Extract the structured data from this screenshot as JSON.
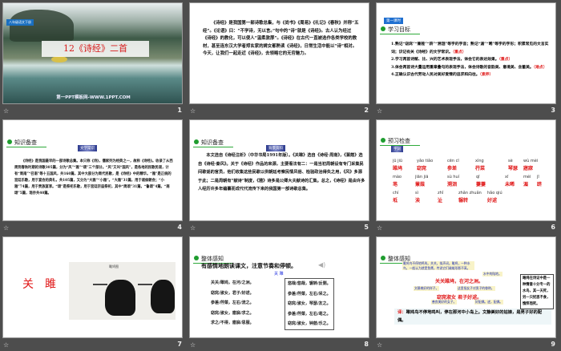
{
  "slides": [
    {
      "number": "1",
      "badge": "八年级语文下册",
      "title": "12《诗经》二首",
      "footer": "第一PPT模板网-WWW.1PPT.COM"
    },
    {
      "number": "2",
      "paragraph": "《诗经》是我国第一部诗歌总集，与《尚书》《周易》《礼记》《春秋》并称“五经”。《论语》曰：“不学诗，无以言。”句中的“诗”就是《诗经》。古人认为经过《诗经》的教化，可以使人“温柔敦厚”。《诗经》在古代一直被选作各类学校的教材，甚至连东汉大学者郑玄家的婢女都熟读《诗经》，日常生活中能以“诗”相对。今天，让我们一起走近《诗经》，去领略它的无穷魅力。"
    },
    {
      "number": "3",
      "badge": "第一课时",
      "heading": "学习目标",
      "goals": [
        {
          "text": "1.熟记“窈窕”“蒹葭”“跻”“溯洄”等字的字音；熟记“湄”“晞”等字的字形；积累常见的文言实词；识记有关《诗经》的文学常识。",
          "tag": "（重点）"
        },
        {
          "text": "2.学习两首诗赋、比、兴的艺术表现手法，体会它的表达效果。",
          "tag": "（重点）"
        },
        {
          "text": "3.体会两首诗大量运用重章叠句的表现手法，体会诗歌的音韵美、意境美、含蓄美。",
          "tag": "（难点）"
        },
        {
          "text": "4.正确认识古代劳动人民对美好爱情的追求和向往。",
          "tag": "（素养）"
        }
      ]
    },
    {
      "number": "4",
      "heading": "知识备查",
      "badge": "文学常识",
      "paragraph": "《诗经》是我国最早的一部诗歌总集。本只称《诗》，儒家列为经典之一，故称《诗经》。收录了从西周到春秋时期的诗歌305篇，分为“风”“雅”“颂”三个部分。“风”又叫“国风”，是各地的民歌民谣，计有“周南”“召南”等十五国风，共160篇，其中大部分为周代民歌，是《诗经》中的精华。“雅”是正统的宫廷乐歌，用于宴会的典礼，共105篇，又分为“大雅”“小雅”。“大雅”31篇，用于诸侯朝会；“小雅”74篇，用于贵族宴享。“颂”是祭祀乐歌，用于宫廷宗庙祭祀，其中“周颂”31篇，“鲁颂”4篇，“商颂”5篇，现存共40篇。"
    },
    {
      "number": "5",
      "heading": "知识备查",
      "badge": "背景资料",
      "paragraph": "本文选自《诗经注析》（中华书局1991年版）。《关雎》选自《诗经·周南》，《蒹葭》选自《诗经·秦风》。关于《诗经》作品的来源，主要看法有二：一是当初周朝设有专门采集民间歌谣的官员，他们收集这些民歌以供朝廷考察民情风俗、检验政治得失之用，《风》多源于此；二是周朝有“献诗”制度，《雅》诗多是公卿大夫献诗的汇集。总之，《诗经》是由许多人经历许多年编纂而成代代流传下来的我国第一部诗歌总集。"
    },
    {
      "number": "6",
      "heading": "预习检查",
      "badge": "字词",
      "words": [
        {
          "py": "jū jiū",
          "hz": "雎鸠"
        },
        {
          "py": "yǎo tiǎo",
          "hz": "窈窕"
        },
        {
          "py": "cēn cī",
          "hz": "参差"
        },
        {
          "py": "xìng",
          "hz": "荇菜"
        },
        {
          "py": "sè",
          "hz": "琴瑟"
        },
        {
          "py": "wù mèi",
          "hz": "寤寐"
        },
        {
          "py": "mào",
          "hz": "芼"
        },
        {
          "py": "jiān jiā",
          "hz": "蒹葭"
        },
        {
          "py": "sù huí",
          "hz": "溯洄"
        },
        {
          "py": "qī",
          "hz": "萋萋"
        },
        {
          "py": "xī",
          "hz": "未晞"
        },
        {
          "py": "méi",
          "hz": "湄"
        },
        {
          "py": "jī",
          "hz": "跻"
        },
        {
          "py": "chí",
          "hz": "坻"
        },
        {
          "py": "sì",
          "hz": "涘"
        },
        {
          "py": "zhǐ",
          "hz": "沚"
        },
        {
          "py": "zhǎn zhuǎn",
          "hz": "辗转"
        },
        {
          "py": "hǎo qiú",
          "hz": "好逑"
        }
      ]
    },
    {
      "number": "7",
      "title": "关　雎",
      "painting_inscription": "雎鸠图"
    },
    {
      "number": "8",
      "heading": "整体感知",
      "instruction": "有感情地朗读课文，注意节奏和停顿。",
      "poem_title": "关 雎",
      "left_lines": [
        "关关/雎鸠，在河/之洲。",
        "窈窕/淑女，君子/好逑。",
        "参差/荇菜，左右/流之。",
        "窈窕/淑女，寤寐/求之。",
        "求之/不得，寤寐/思服。"
      ],
      "right_lines": [
        "悠哉/悠哉，辗转/反侧。",
        "参差/荇菜，左右/采之。",
        "窈窕/淑女，琴瑟/友之。",
        "参差/荇菜，左右/芼之。",
        "窈窕/淑女，钟鼓/乐之。"
      ]
    },
    {
      "number": "9",
      "heading": "整体感知",
      "notes": [
        "雎鸠鸟不停地鸣叫。关关，拟声词。雎鸠，一种水鸟，一般认为就是鱼鹰，传说它们雌雄形影不离。",
        "水中的陆地。",
        "文静美好的样子。",
        "这里指女子对男子的尊称。",
        "善良美好的女子。",
        "好配偶。逑，配偶。"
      ],
      "line1": "关关雎鸠，在河之洲。",
      "line2a": "窈窕淑女",
      "line2b": "君子好逑。",
      "translation_label": "译：",
      "translation": "雎鸠鸟不停地鸣叫，停在那河中小岛上。文静美好的姑娘，是男子好的配偶。",
      "sidebox": "雎鸠在诗证中是一种情意十分专一的水鸟，其一天死，另一只忧思不食，憔悴而死。"
    }
  ]
}
